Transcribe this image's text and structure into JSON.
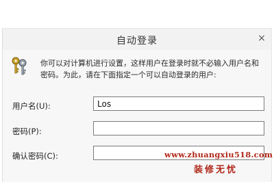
{
  "window": {
    "title": "自动登录",
    "close_glyph": "×"
  },
  "description": "你可以对计算机进行设置，这样用户在登录时就不必输入用户名和密码。为此，请在下面指定一个可以自动登录的用户:",
  "fields": {
    "username": {
      "label": "用户名(U):",
      "value": "Los"
    },
    "password": {
      "label": "密码(P):",
      "value": ""
    },
    "confirm_password": {
      "label": "确认密码(C):",
      "value": ""
    }
  },
  "watermark": {
    "url": "www.zhuangxiu518.com",
    "text": "装修无忧"
  },
  "icons": {
    "keys": "keys-icon",
    "close": "close-icon"
  }
}
